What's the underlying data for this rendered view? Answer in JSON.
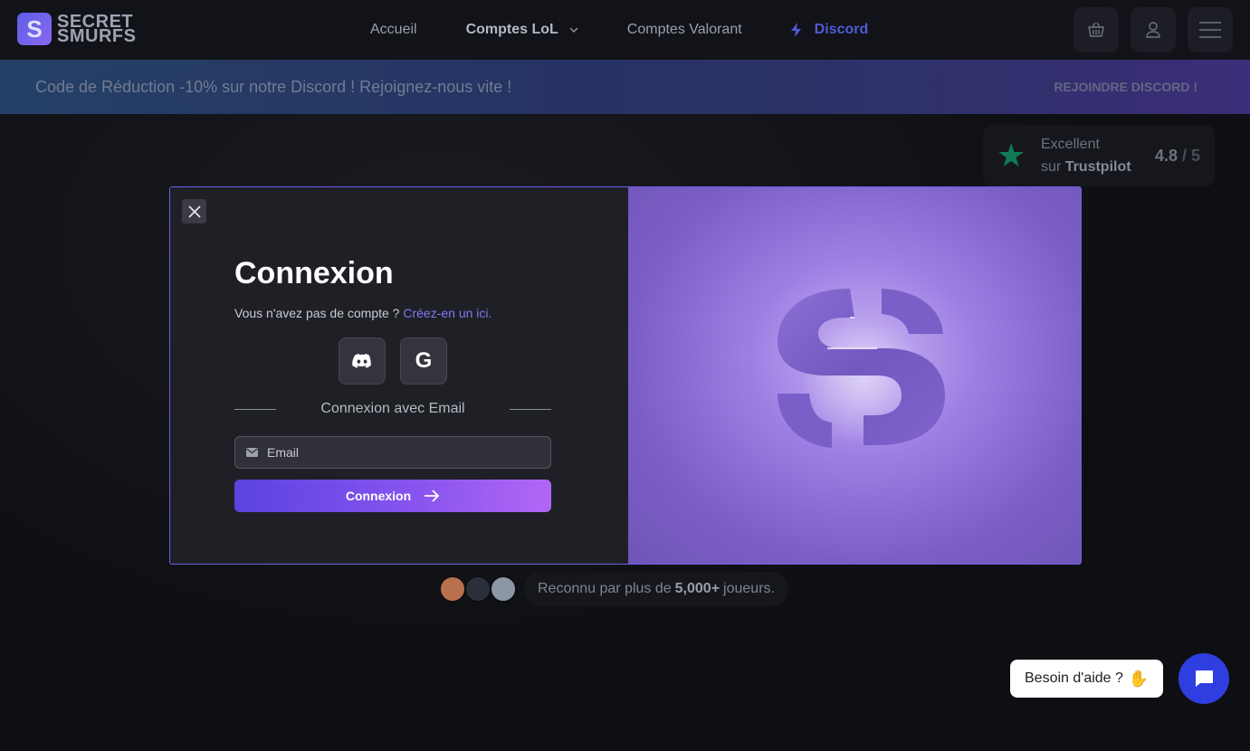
{
  "brand": {
    "logo_letter": "S",
    "line1": "SECRET",
    "line2": "SMURFS"
  },
  "nav": {
    "links": [
      "Accueil",
      "Comptes LoL",
      "Comptes Valorant"
    ],
    "discord_label": "Discord",
    "icons": [
      "basket-icon",
      "user-icon",
      "menu-icon"
    ]
  },
  "banner": {
    "text": "Code de Réduction -10% sur notre Discord ! Rejoignez-nous vite !",
    "cta": "REJOINDRE DISCORD !"
  },
  "trustpilot": {
    "line1": "Excellent",
    "line2_prefix": "sur",
    "line2_brand": "Trustpilot",
    "score": "4.8",
    "max": "/ 5"
  },
  "modal": {
    "title": "Connexion",
    "subtitle": "Vous n'avez pas de compte ?",
    "signup_link": "Créez-en un ici.",
    "divider": "Connexion avec Email",
    "email_placeholder": "Email",
    "submit": "Connexion",
    "social": [
      "discord-icon",
      "google-icon"
    ],
    "google_glyph": "G"
  },
  "recognition": {
    "prefix": "Reconnu par plus de",
    "count": "5,000+",
    "suffix": "joueurs."
  },
  "help": {
    "text": "Besoin d'aide ?"
  },
  "colors": {
    "accent": "#6e5ee6",
    "discord": "#4f5ad6",
    "chat": "#2f3ee0",
    "trust_green": "#0f7a55"
  }
}
